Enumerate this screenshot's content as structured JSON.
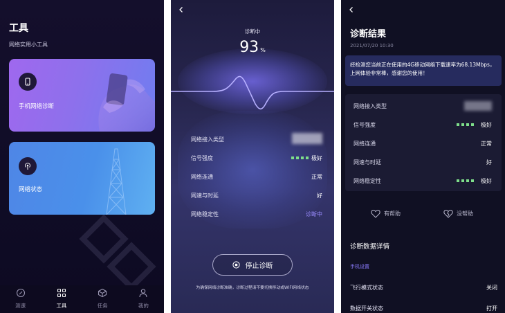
{
  "tools": {
    "title": "工具",
    "subtitle": "网络实用小工具",
    "cards": [
      {
        "label": "手机网络诊断",
        "icon": "phone-icon"
      },
      {
        "label": "网络状态",
        "icon": "signal-tower-icon"
      }
    ],
    "tabs": [
      {
        "label": "测速",
        "icon": "compass-icon",
        "active": false
      },
      {
        "label": "工具",
        "icon": "grid-icon",
        "active": true
      },
      {
        "label": "任务",
        "icon": "cube-icon",
        "active": false
      },
      {
        "label": "我的",
        "icon": "user-icon",
        "active": false
      }
    ]
  },
  "diagnosing": {
    "status": "诊断中",
    "percent": "93",
    "percent_unit": "%",
    "rows": [
      {
        "label": "网络接入类型",
        "value": ""
      },
      {
        "label": "信号强度",
        "value": "极好"
      },
      {
        "label": "网络连通",
        "value": "正常"
      },
      {
        "label": "网速与时延",
        "value": "好"
      },
      {
        "label": "网络稳定性",
        "value": "诊断中"
      }
    ],
    "stop_label": "停止诊断",
    "note": "为确保网络诊断准确，诊断过程请不要切换移动或WIFI网络状态",
    "accent_color": "#9a8cff",
    "signal_color": "#7ede8a"
  },
  "results": {
    "title": "诊断结果",
    "date": "2021/07/20  10:30",
    "summary": "经检测您当前正在使用的4G移动网络下载速率为68.13Mbps，上网体验非常棒，感谢您的使用！",
    "rows": [
      {
        "label": "网络接入类型",
        "value": ""
      },
      {
        "label": "信号强度",
        "value": "极好"
      },
      {
        "label": "网络连通",
        "value": "正常"
      },
      {
        "label": "网速与时延",
        "value": "好"
      },
      {
        "label": "网络稳定性",
        "value": "极好"
      }
    ],
    "helpful_label": "有帮助",
    "not_helpful_label": "没帮助",
    "details_title": "诊断数据详情",
    "phone_settings_label": "手机设置",
    "settings": [
      {
        "label": "飞行模式状态",
        "value": "关闭"
      },
      {
        "label": "数据开关状态",
        "value": "打开"
      }
    ]
  }
}
